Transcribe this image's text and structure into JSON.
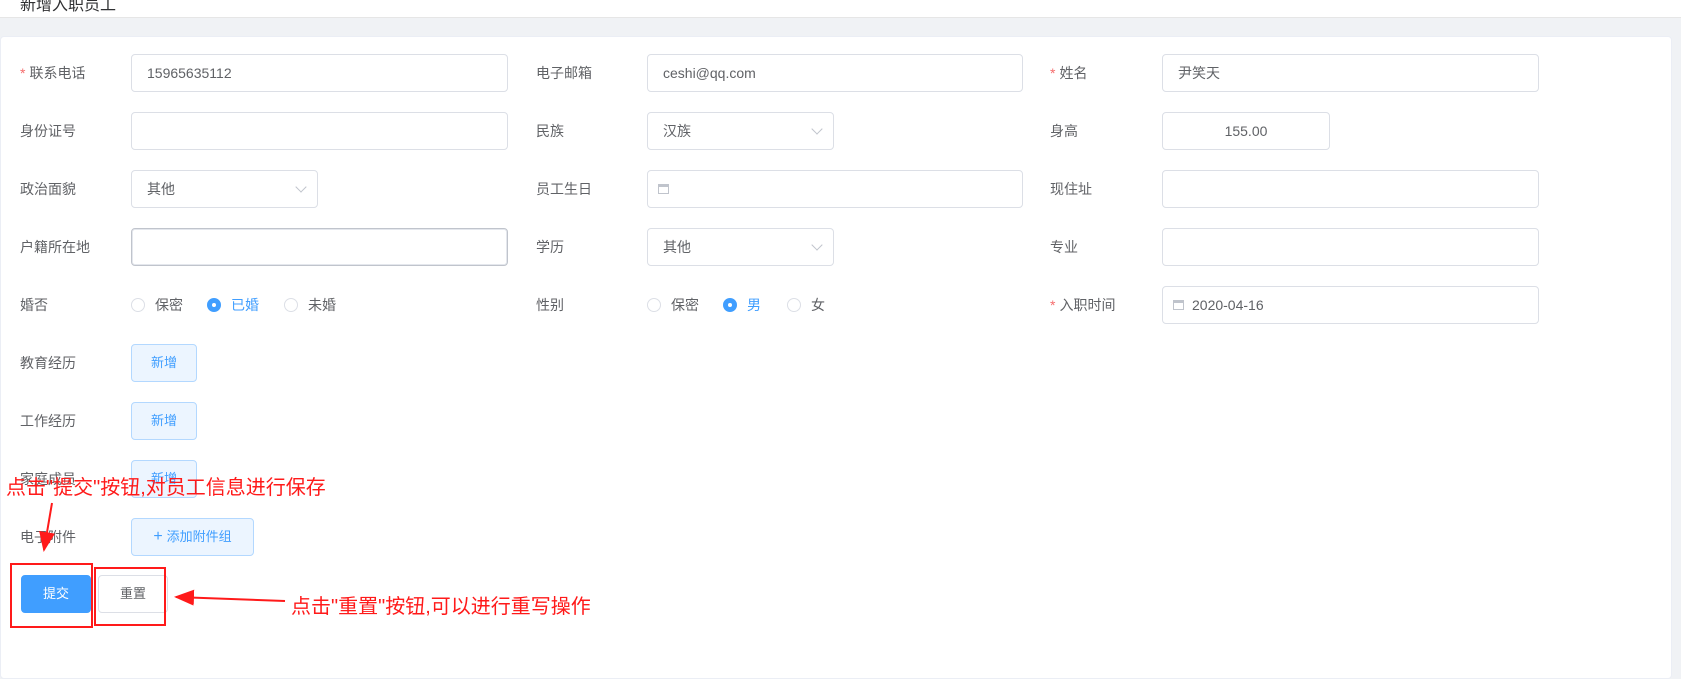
{
  "breadcrumb": {
    "current": "新增入职员工"
  },
  "form": {
    "phone": {
      "label": "联系电话",
      "required": "*",
      "value": "15965635112"
    },
    "email": {
      "label": "电子邮箱",
      "value": "ceshi@qq.com"
    },
    "name": {
      "label": "姓名",
      "required": "*",
      "value": "尹笑天"
    },
    "id_card": {
      "label": "身份证号",
      "value": ""
    },
    "ethnicity": {
      "label": "民族",
      "value": "汉族"
    },
    "height": {
      "label": "身高",
      "value": "155.00"
    },
    "political": {
      "label": "政治面貌",
      "value": "其他"
    },
    "birthday": {
      "label": "员工生日",
      "value": ""
    },
    "address": {
      "label": "现住址",
      "value": ""
    },
    "hukou": {
      "label": "户籍所在地",
      "value": ""
    },
    "education": {
      "label": "学历",
      "value": "其他"
    },
    "major": {
      "label": "专业",
      "value": ""
    },
    "marital": {
      "label": "婚否",
      "options": [
        "保密",
        "已婚",
        "未婚"
      ],
      "selected": "已婚"
    },
    "gender": {
      "label": "性别",
      "options": [
        "保密",
        "男",
        "女"
      ],
      "selected": "男"
    },
    "hire_date": {
      "label": "入职时间",
      "required": "*",
      "value": "2020-04-16"
    },
    "edu_history": {
      "label": "教育经历",
      "button": "新增"
    },
    "work_history": {
      "label": "工作经历",
      "button": "新增"
    },
    "family": {
      "label": "家庭成员",
      "button": "新增"
    },
    "attachments": {
      "label": "电子附件",
      "button": "添加附件组",
      "icon": "plus-icon"
    }
  },
  "actions": {
    "submit": "提交",
    "reset": "重置"
  },
  "annotations": {
    "submit_note": "点击\"提交\"按钮,对员工信息进行保存",
    "reset_note": "点击\"重置\"按钮,可以进行重写操作",
    "color": "#ff1a1a"
  },
  "colors": {
    "primary": "#409eff",
    "required": "#f56c6c",
    "annotation": "#ff1a1a"
  }
}
